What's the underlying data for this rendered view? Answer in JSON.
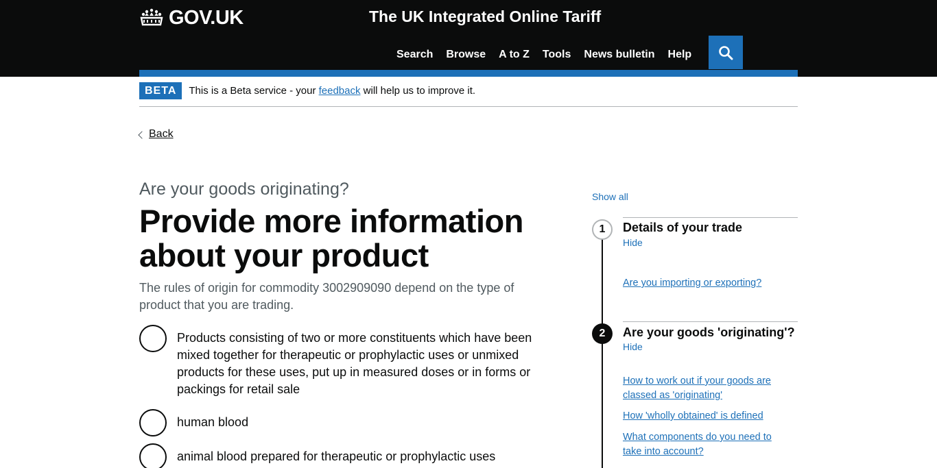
{
  "header": {
    "logo_text": "GOV.UK",
    "service_name": "The UK Integrated Online Tariff",
    "nav": [
      "Search",
      "Browse",
      "A to Z",
      "Tools",
      "News bulletin",
      "Help"
    ]
  },
  "phase_banner": {
    "tag": "BETA",
    "text_before": "This is a Beta service - your ",
    "link": "feedback",
    "text_after": " will help us to improve it."
  },
  "back_link": "Back",
  "main": {
    "caption": "Are your goods originating?",
    "heading": "Provide more information about your product",
    "hint": "The rules of origin for commodity 3002909090 depend on the type of product that you are trading.",
    "options": [
      "Products consisting of two or more constituents which have been mixed together for therapeutic or prophylactic uses or unmixed products for these uses, put up in measured doses or in forms or packings for retail sale",
      "human blood",
      "animal blood prepared for therapeutic or prophylactic uses"
    ]
  },
  "sidebar": {
    "show_all": "Show all",
    "steps": [
      {
        "number": "1",
        "title": "Details of your trade",
        "toggle": "Hide",
        "links": [
          "Are you importing or exporting?"
        ]
      },
      {
        "number": "2",
        "title": "Are your goods 'originating'?",
        "toggle": "Hide",
        "links": [
          "How to work out if your goods are classed as 'originating'",
          "How 'wholly obtained' is defined",
          "What components do you need to take into account?"
        ]
      }
    ]
  },
  "colors": {
    "header_bg": "#0b0c0c",
    "brand_blue": "#1d70b8",
    "secondary_text": "#505a5f",
    "border": "#b1b4b6"
  }
}
